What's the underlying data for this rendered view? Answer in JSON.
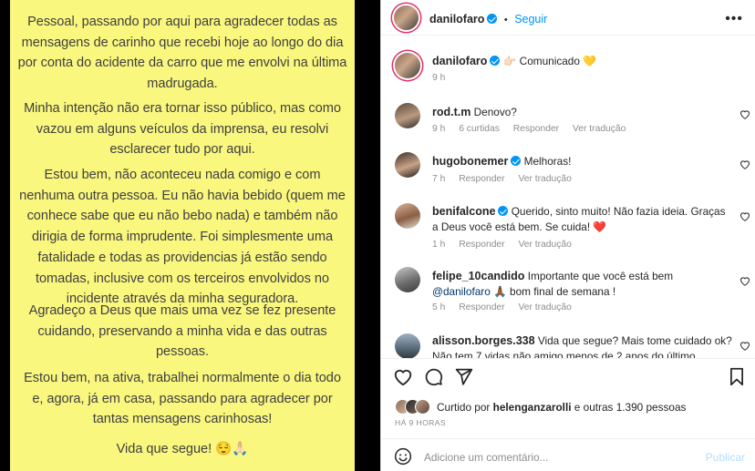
{
  "image": {
    "paragraphs": [
      "Pessoal, passando por aqui para agradecer todas as mensagens de carinho que recebi hoje ao longo do dia por conta do acidente da carro que me envolvi na última madrugada.",
      "Minha intenção não era tornar isso público, mas como vazou em alguns veículos da imprensa, eu resolvi esclarecer tudo por aqui.",
      "Estou bem, não aconteceu nada comigo e com nenhuma outra pessoa. Eu não havia bebido (quem me conhece sabe que eu não bebo nada) e também não dirigia de forma imprudente. Foi simplesmente uma fatalidade e todas as providencias já estão sendo tomadas, inclusive com os terceiros envolvidos no incidente através da minha seguradora.",
      "Agradeço a Deus que mais uma vez se fez presente cuidando, preservando a minha vida e das outras pessoas.",
      "Estou bem, na ativa, trabalhei normalmente o dia todo e, agora, já em casa, passando para agradecer por tantas mensagens carinhosas!",
      "Vida que segue! 😌🙏🏻"
    ]
  },
  "header": {
    "username": "danilofaro",
    "separator": "•",
    "follow_label": "Seguir",
    "more_label": "•••"
  },
  "caption": {
    "username": "danilofaro",
    "text": "👉🏻 Comunicado 💛",
    "time": "9 h"
  },
  "comments": [
    {
      "username": "rod.t.m",
      "text": "Denovo?",
      "verified": false,
      "time": "9 h",
      "likes": "6 curtidas",
      "reply": "Responder",
      "translate": "Ver tradução"
    },
    {
      "username": "hugobonemer",
      "text": "Melhoras!",
      "verified": true,
      "time": "7 h",
      "reply": "Responder",
      "translate": "Ver tradução"
    },
    {
      "username": "benifalcone",
      "text": "Querido, sinto muito! Não fazia ideia. Graças a Deus você está bem. Se cuida! ❤️",
      "verified": true,
      "time": "1 h",
      "reply": "Responder",
      "translate": "Ver tradução"
    },
    {
      "username": "felipe_10candido",
      "text": "Importante que você está bem",
      "mention": "@danilofaro",
      "text2": "🙏🏾 bom final de semana !",
      "verified": false,
      "time": "5 h",
      "reply": "Responder",
      "translate": "Ver tradução"
    },
    {
      "username": "alisson.borges.338",
      "text": "Vida que segue? Mais tome cuidado ok?",
      "text2": "Não tem 7 vidas não amigo menos de 2 anos do último",
      "verified": false
    }
  ],
  "likes": {
    "label": "Curtido por",
    "user": "helenganzarolli",
    "rest": "e outras 1.390 pessoas"
  },
  "posted_ago": "HÁ 9 HORAS",
  "add_comment": {
    "placeholder": "Adicione um comentário...",
    "publish_label": "Publicar"
  },
  "colors": {
    "note_background": "#faf77f",
    "accent": "#0095f6",
    "heart": "#ed4956"
  }
}
